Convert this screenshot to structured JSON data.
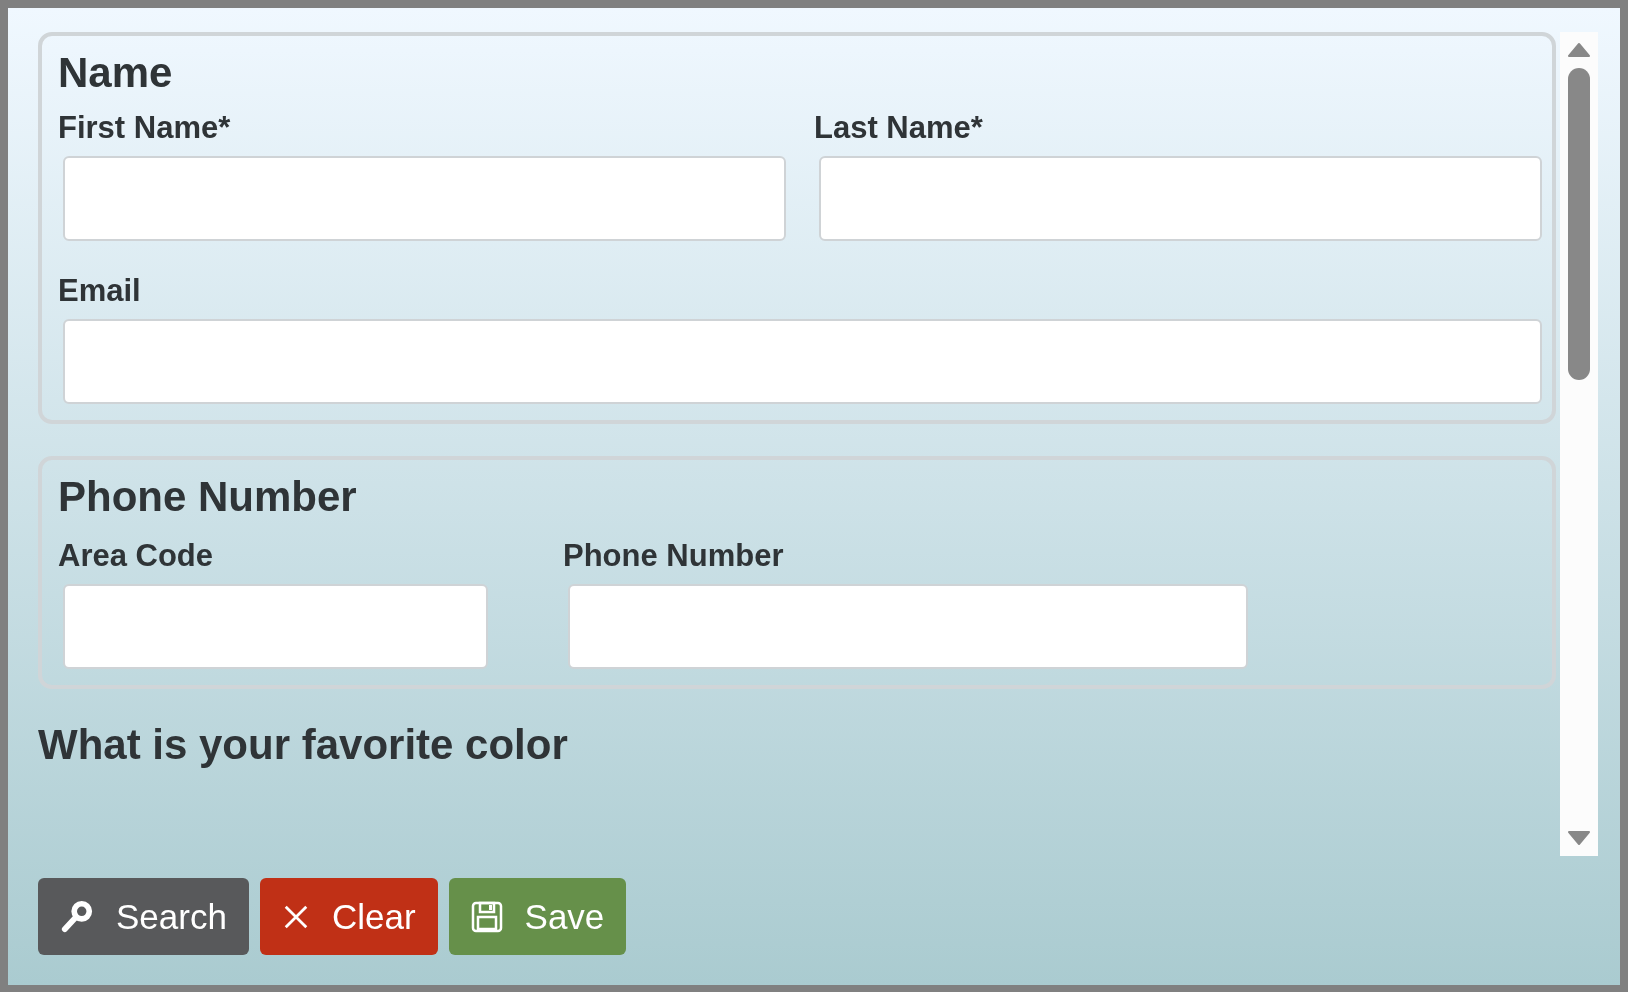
{
  "sections": [
    {
      "title": "Name",
      "rows": [
        [
          {
            "label": "First Name*"
          },
          {
            "label": "Last Name*"
          }
        ],
        [
          {
            "label": "Email"
          }
        ]
      ]
    },
    {
      "title": "Phone Number",
      "rows": [
        [
          {
            "label": "Area Code"
          },
          {
            "label": "Phone Number"
          }
        ]
      ]
    }
  ],
  "next_heading": "What is your favorite color",
  "buttons": [
    {
      "label": "Search",
      "kind": "search"
    },
    {
      "label": "Clear",
      "kind": "clear"
    },
    {
      "label": "Save",
      "kind": "save"
    }
  ]
}
